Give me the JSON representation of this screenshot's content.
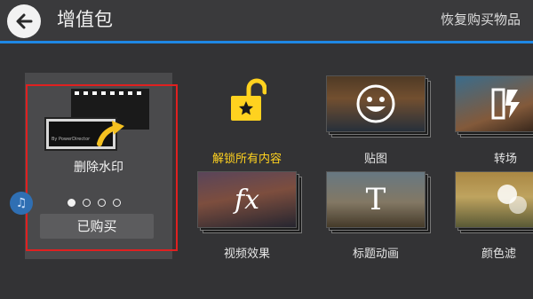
{
  "header": {
    "title": "增值包",
    "restore_label": "恢复购买物品",
    "back_icon": "arrow-left-icon",
    "accent_color": "#1e88e5"
  },
  "featured": {
    "label": "删除水印",
    "watermark_text": "By PowerDirector",
    "button_label": "已购买",
    "pagination": {
      "count": 4,
      "active": 1
    },
    "highlight_color": "#e02020"
  },
  "unlock_all": {
    "label": "解锁所有内容",
    "icon": "unlock-icon",
    "color": "#ffd21f"
  },
  "packs": [
    {
      "label": "贴图",
      "icon": "smiley-icon"
    },
    {
      "label": "转场",
      "icon": "transition-icon"
    },
    {
      "label": "视频效果",
      "icon": "fx-icon",
      "glyph": "fx"
    },
    {
      "label": "标题动画",
      "icon": "title-t-icon",
      "glyph": "T"
    },
    {
      "label": "颜色滤",
      "icon": "color-filter-icon"
    }
  ],
  "fab": {
    "icon": "music-note-icon"
  }
}
